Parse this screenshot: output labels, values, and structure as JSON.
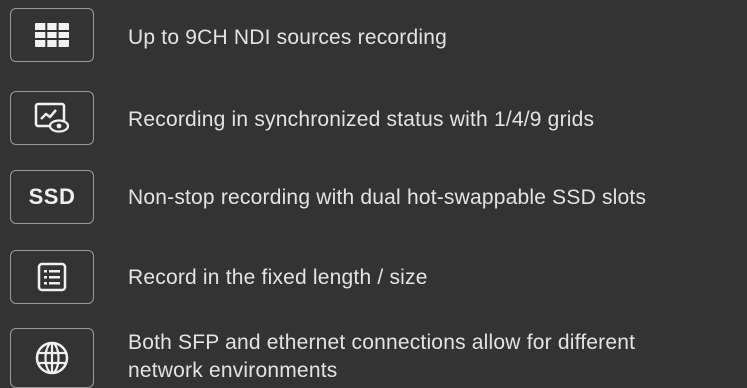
{
  "features": [
    {
      "icon": "grid-icon",
      "text": "Up to 9CH NDI sources recording"
    },
    {
      "icon": "monitor-eye-icon",
      "text": "Recording in synchronized status with 1/4/9 grids"
    },
    {
      "icon": "ssd-icon",
      "icon_label": "SSD",
      "text": "Non-stop recording with dual hot-swappable SSD slots"
    },
    {
      "icon": "list-document-icon",
      "text": "Record in the fixed length / size"
    },
    {
      "icon": "globe-icon",
      "text_line1": "Both SFP and ethernet connections allow for different",
      "text_line2": "network environments"
    }
  ],
  "colors": {
    "background": "#333333",
    "text": "#e3e3e3",
    "border": "#9a9a9a"
  }
}
